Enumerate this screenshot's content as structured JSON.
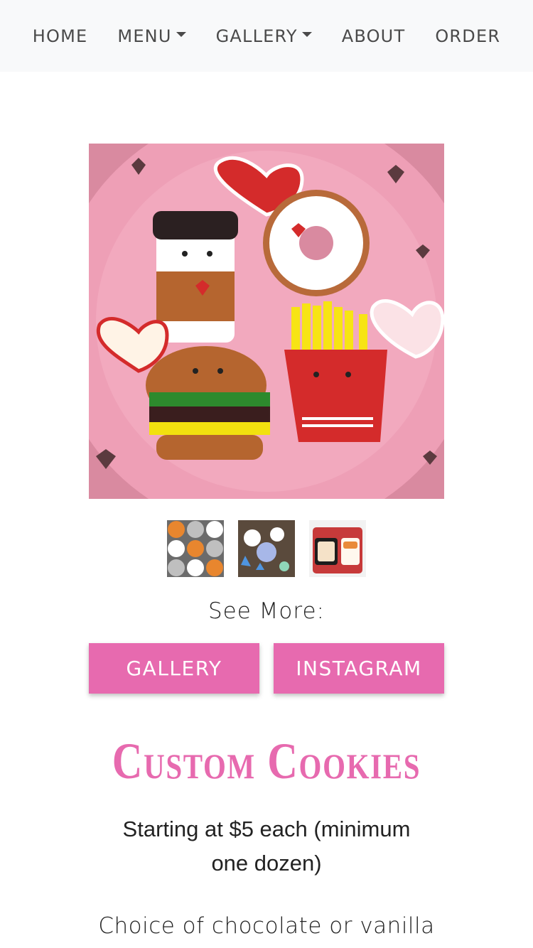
{
  "nav": {
    "items": [
      {
        "label": "HOME",
        "dropdown": false
      },
      {
        "label": "MENU",
        "dropdown": true
      },
      {
        "label": "GALLERY",
        "dropdown": true
      },
      {
        "label": "ABOUT",
        "dropdown": false
      },
      {
        "label": "ORDER",
        "dropdown": false
      }
    ]
  },
  "hero": {
    "icon": "cookie-plate-photo"
  },
  "thumbnails": [
    {
      "icon": "cat-cookies-thumbnail"
    },
    {
      "icon": "ocean-cookies-thumbnail"
    },
    {
      "icon": "sushi-cookies-thumbnail"
    }
  ],
  "see_more": {
    "label": "See More:",
    "gallery_button": "GALLERY",
    "instagram_button": "INSTAGRAM"
  },
  "product": {
    "title": "Custom Cookies",
    "pricing": "Starting at $5 each (minimum one dozen)",
    "flavors": "Choice of chocolate or vanilla"
  },
  "colors": {
    "accent": "#e76aaf",
    "navbar_bg": "#f8f9fa",
    "nav_text": "#4a4a4a"
  }
}
